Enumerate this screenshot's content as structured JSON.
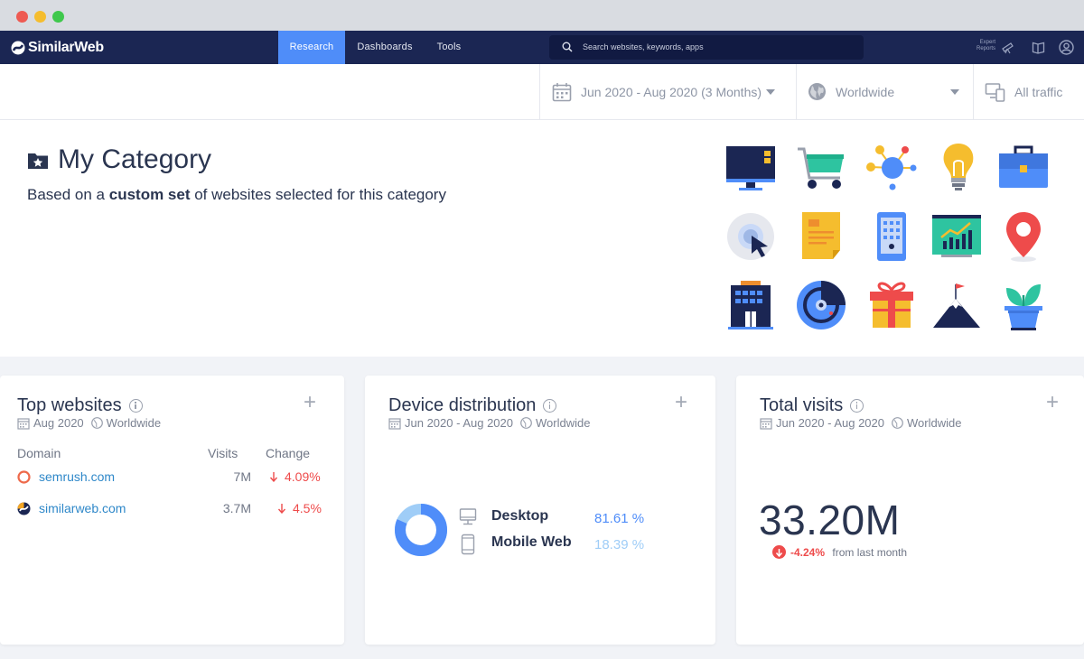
{
  "window": {
    "controls": [
      "close",
      "minimize",
      "maximize"
    ]
  },
  "nav": {
    "logo": "SimilarWeb",
    "tabs": [
      {
        "label": "Research",
        "active": true
      },
      {
        "label": "Dashboards",
        "active": false
      },
      {
        "label": "Tools",
        "active": false
      }
    ],
    "search_placeholder": "Search websites, keywords, apps",
    "expert_reports": "Expert Reports",
    "accent_color": "#4f8df9",
    "bg_color": "#1b2653"
  },
  "filters": {
    "date_range": "Jun 2020 - Aug 2020 (3 Months)",
    "region": "Worldwide",
    "traffic": "All traffic"
  },
  "hero": {
    "title": "My Category",
    "subtitle_pre": "Based on a ",
    "subtitle_bold": "custom set",
    "subtitle_post": " of websites selected for this category",
    "icons": [
      "monitor-icon",
      "shopping-cart-icon",
      "network-icon",
      "lightbulb-icon",
      "briefcase-icon",
      "cursor-icon",
      "document-icon",
      "phone-icon",
      "chart-board-icon",
      "map-pin-icon",
      "building-icon",
      "radar-icon",
      "gift-icon",
      "mountain-icon",
      "plant-icon"
    ]
  },
  "top_websites": {
    "title": "Top websites",
    "period": "Aug 2020",
    "region": "Worldwide",
    "columns": [
      "Domain",
      "Visits",
      "Change"
    ],
    "rows": [
      {
        "domain": "semrush.com",
        "visits": "7M",
        "change": "4.09%"
      },
      {
        "domain": "similarweb.com",
        "visits": "3.7M",
        "change": "4.5%"
      }
    ]
  },
  "device_distribution": {
    "title": "Device distribution",
    "period": "Jun 2020 - Aug 2020",
    "region": "Worldwide",
    "rows": [
      {
        "label": "Desktop",
        "value": "81.61 %",
        "color": "#4f8df9"
      },
      {
        "label": "Mobile Web",
        "value": "18.39 %",
        "color": "#9fcdf7"
      }
    ],
    "desktop_share": 81.61,
    "mobile_share": 18.39
  },
  "total_visits": {
    "title": "Total visits",
    "period": "Jun 2020 - Aug 2020",
    "region": "Worldwide",
    "value": "33.20M",
    "change": "-4.24%",
    "change_suffix": " from last month"
  }
}
